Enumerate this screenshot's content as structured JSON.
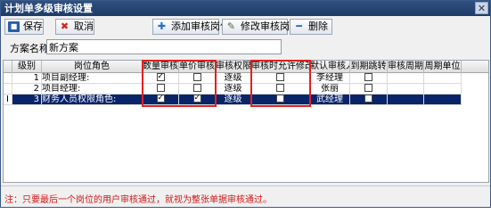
{
  "window": {
    "title": "计划单多级审核设置",
    "close_glyph": "✕"
  },
  "toolbar": {
    "save_label": "保存",
    "cancel_label": "取消",
    "add_label": "添加审核岗位",
    "edit_label": "修改审核岗位",
    "delete_label": "删除",
    "icons": {
      "save": "floppy-icon",
      "cancel": "x-icon",
      "add": "plus-icon",
      "edit": "edit-icon",
      "delete": "minus-icon"
    }
  },
  "scheme": {
    "label": "方案名称",
    "value": "新方案"
  },
  "grid": {
    "columns": [
      "级别",
      "岗位角色",
      "数量审核",
      "单价审核",
      "审核权限",
      "审核时允许修改",
      "默认审核人",
      "到期跳转",
      "审核周期",
      "周期单位"
    ],
    "rows": [
      {
        "indicator": "",
        "level": "1",
        "role": "项目副经理:",
        "qty_audit": true,
        "price_audit": false,
        "permission": "逐级",
        "allow_modify": false,
        "default_auditor": "李经理",
        "expire_jump": false,
        "cycle": "",
        "cycle_unit": ""
      },
      {
        "indicator": "",
        "level": "2",
        "role": "项目经理:",
        "qty_audit": false,
        "price_audit": false,
        "permission": "逐级",
        "allow_modify": false,
        "default_auditor": "张丽",
        "expire_jump": false,
        "cycle": "",
        "cycle_unit": ""
      },
      {
        "indicator": "I",
        "level": "3",
        "role": "财务人员权限角色:",
        "qty_audit": true,
        "price_audit": true,
        "permission": "逐级",
        "allow_modify": false,
        "default_auditor": "武经理",
        "expire_jump": false,
        "cycle": "",
        "cycle_unit": ""
      }
    ],
    "selected_row": 2
  },
  "footer": {
    "note": "注：只要最后一个岗位的用户审核通过，就视为整张单据审核通过。"
  },
  "colors": {
    "title_bar": "#2f4f7f",
    "selection": "#0a246a",
    "highlight_box": "#e02020",
    "note_text": "#d21818"
  }
}
